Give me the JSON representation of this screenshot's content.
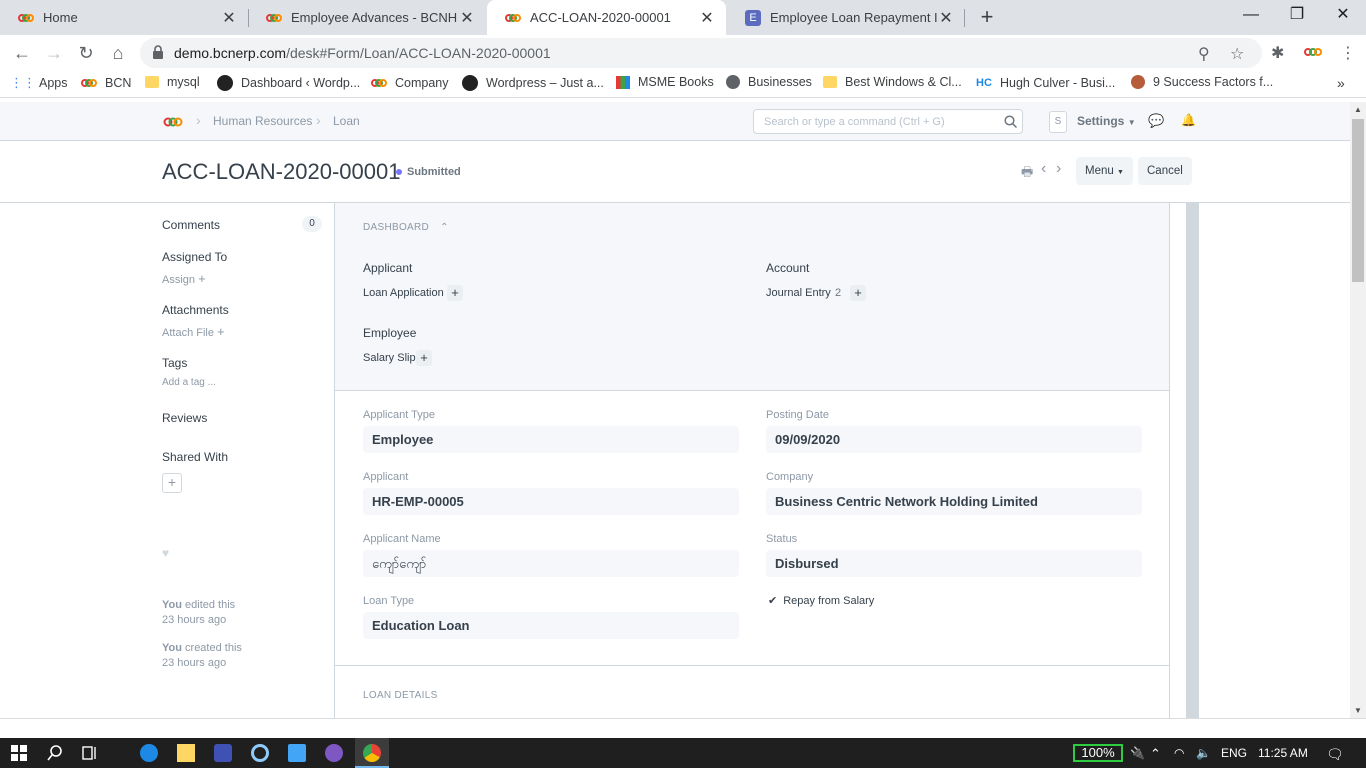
{
  "browser": {
    "tabs": [
      {
        "label": "Home"
      },
      {
        "label": "Employee Advances - BCNHL"
      },
      {
        "label": "ACC-LOAN-2020-00001"
      },
      {
        "label": "Employee Loan Repayment Issue"
      }
    ],
    "url_host": "demo.bcnerp.com",
    "url_path": "/desk#Form/Loan/ACC-LOAN-2020-00001",
    "bookmarks": [
      "Apps",
      "BCN",
      "mysql",
      "Dashboard ‹ Wordp...",
      "Company",
      "Wordpress – Just a...",
      "MSME Books",
      "Businesses",
      "Best Windows & Cl...",
      "Hugh Culver - Busi...",
      "9 Success Factors f..."
    ]
  },
  "navbar": {
    "breadcrumbs": [
      "Human Resources",
      "Loan"
    ],
    "search_placeholder": "Search or type a command (Ctrl + G)",
    "avatar_letter": "S",
    "settings_label": "Settings"
  },
  "page": {
    "title": "ACC-LOAN-2020-00001",
    "status": "Submitted",
    "menu_label": "Menu",
    "cancel_label": "Cancel"
  },
  "sidebar": {
    "comments_label": "Comments",
    "comments_count": "0",
    "assigned_to": "Assigned To",
    "assign": "Assign",
    "attachments": "Attachments",
    "attach_file": "Attach File",
    "tags": "Tags",
    "add_tag": "Add a tag ...",
    "reviews": "Reviews",
    "shared_with": "Shared With",
    "edited_by": "You",
    "edited_text": "edited this",
    "edited_time": "23 hours ago",
    "created_by": "You",
    "created_text": "created this",
    "created_time": "23 hours ago"
  },
  "dashboard": {
    "heading": "DASHBOARD",
    "groups": [
      {
        "title": "Applicant",
        "link": "Loan Application",
        "count": ""
      },
      {
        "title": "Account",
        "link": "Journal Entry",
        "count": "2"
      },
      {
        "title": "Employee",
        "link": "Salary Slip",
        "count": ""
      }
    ]
  },
  "form": {
    "applicant_type_label": "Applicant Type",
    "applicant_type": "Employee",
    "posting_date_label": "Posting Date",
    "posting_date": "09/09/2020",
    "applicant_label": "Applicant",
    "applicant": "HR-EMP-00005",
    "company_label": "Company",
    "company": "Business Centric Network Holding Limited",
    "applicant_name_label": "Applicant Name",
    "applicant_name": "ကျော်ကျော်",
    "status_label": "Status",
    "status": "Disbursed",
    "loan_type_label": "Loan Type",
    "loan_type": "Education Loan",
    "repay_from_salary": "Repay from Salary",
    "loan_details_heading": "LOAN DETAILS"
  },
  "taskbar": {
    "battery": "100%",
    "lang": "ENG",
    "time": "11:25 AM"
  }
}
